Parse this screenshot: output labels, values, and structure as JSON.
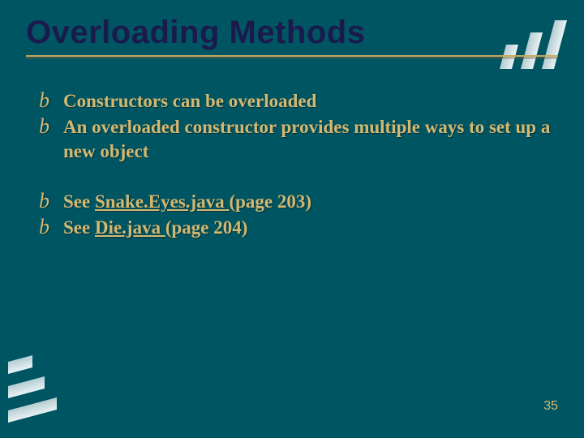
{
  "title": "Overloading Methods",
  "bullets_group1": [
    {
      "text": "Constructors can be overloaded"
    },
    {
      "text": "An overloaded constructor provides multiple ways to set up a new object"
    }
  ],
  "bullets_group2": [
    {
      "prefix": "See ",
      "link": "Snake.Eyes.java ",
      "suffix": "(page 203)"
    },
    {
      "prefix": "See ",
      "link": "Die.java ",
      "suffix": "(page 204)"
    }
  ],
  "page_number": "35",
  "bullet_char": "b"
}
